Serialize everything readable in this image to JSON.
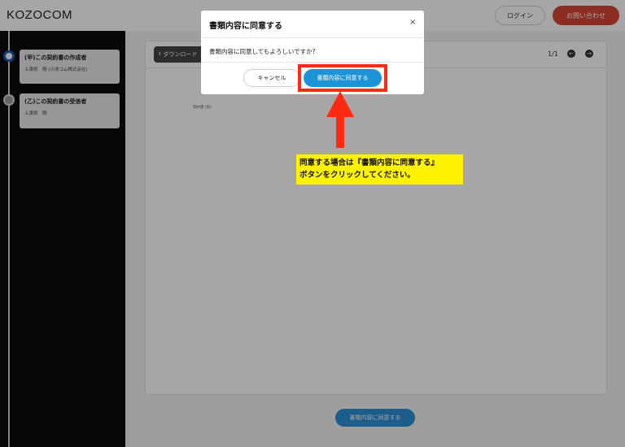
{
  "header": {
    "logo": "KOZOCOM",
    "login_label": "ログイン",
    "contact_label": "お問い合わせ"
  },
  "sidebar": {
    "steps": [
      {
        "title": "(甲)この契約書の作成者",
        "subtitle": "上津原　剛 (小池コム株式会社)",
        "status": "active"
      },
      {
        "title": "(乙)この契約書の受信者",
        "subtitle": "上津原　剛",
        "status": "pending"
      }
    ]
  },
  "document": {
    "download_label": "ダウンロード",
    "page_count": "1/1",
    "doc_label": "契約書 (仮)",
    "bottom_agree_label": "書類内容に同意する"
  },
  "modal": {
    "title": "書類内容に同意する",
    "close_symbol": "×",
    "message": "書類内容に同意してもよろしいですか?",
    "cancel_label": "キャンセル",
    "confirm_label": "書類内容に同意する"
  },
  "annotation": {
    "line1": "同意する場合は『書類内容に同意する』",
    "line2": "ボタンをクリックしてください。"
  },
  "colors": {
    "accent_blue": "#1e94d8",
    "brand_red": "#d64535",
    "highlight_red": "#ff2a10",
    "callout_yellow": "#fff200"
  }
}
